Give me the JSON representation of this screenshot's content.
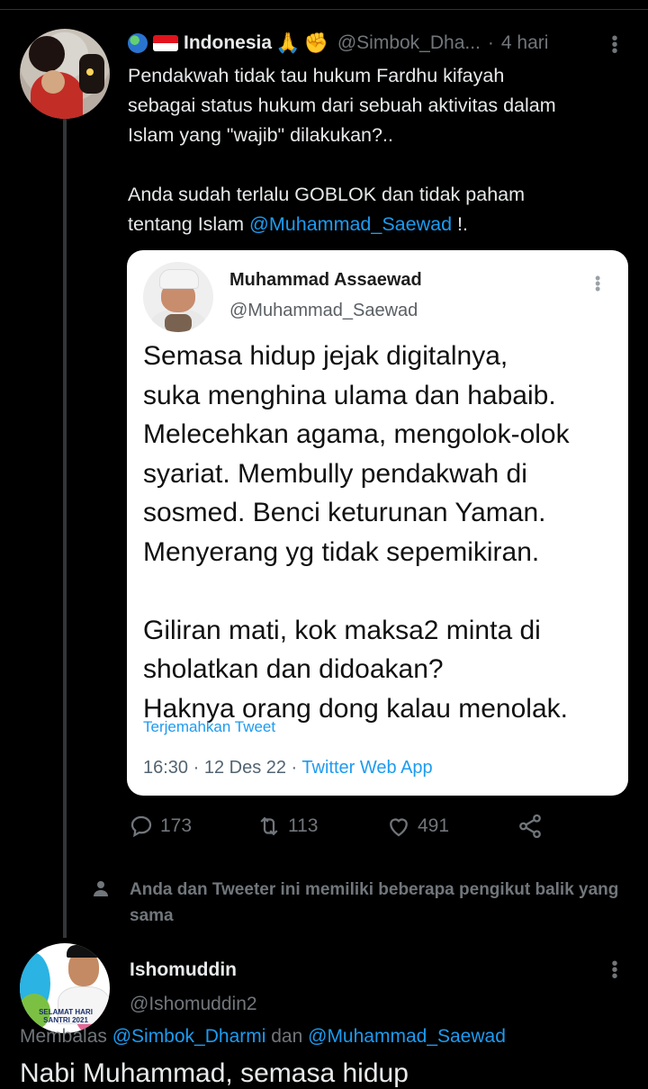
{
  "tweet": {
    "display_name": "Indonesia",
    "handle": "@Simbok_Dha...",
    "time": "4 hari",
    "text_lines": [
      "Pendakwah tidak tau hukum Fardhu kifayah",
      "sebagai status hukum dari sebuah aktivitas dalam",
      "Islam yang \"wajib\" dilakukan?..",
      "Anda sudah terlalu GOBLOK dan tidak paham"
    ],
    "text_last_prefix": "tentang Islam ",
    "text_mention": "@Muhammad_Saewad",
    "text_last_suffix": " !."
  },
  "quote": {
    "name": "Muhammad Assaewad",
    "handle": "@Muhammad_Saewad",
    "body_lines": [
      "Semasa hidup jejak digitalnya,",
      "suka menghina ulama dan habaib.",
      "Melecehkan agama, mengolok-olok",
      "syariat. Membully pendakwah di",
      "sosmed. Benci keturunan Yaman.",
      "Menyerang yg tidak sepemikiran.",
      "Giliran mati, kok maksa2 minta di",
      "sholatkan dan didoakan?",
      "Haknya orang dong kalau menolak."
    ],
    "translate_label": "Terjemahkan Tweet",
    "timestamp": "16:30 · 12 Des 22 · ",
    "source_app": "Twitter Web App"
  },
  "actions": {
    "replies": "173",
    "retweets": "113",
    "likes": "491"
  },
  "notice": {
    "text": "Anda dan Tweeter ini memiliki beberapa pengikut balik yang sama"
  },
  "reply": {
    "display_name": "Ishomuddin",
    "handle": "@Ishomuddin2",
    "avatar_caption": "SELAMAT HARI SANTRI 2021",
    "replying_prefix": "Membalas ",
    "replying_mention_1": "@Simbok_Dharmi",
    "replying_and": " dan ",
    "replying_mention_2": "@Muhammad_Saewad",
    "text_start": "Nabi Muhammad, semasa hidup"
  },
  "colors": {
    "background": "#000000",
    "link": "#1d9bf0",
    "secondary_text": "#71767b"
  },
  "icons": [
    "more-icon",
    "reply-icon",
    "retweet-icon",
    "like-icon",
    "share-icon",
    "person-icon"
  ]
}
